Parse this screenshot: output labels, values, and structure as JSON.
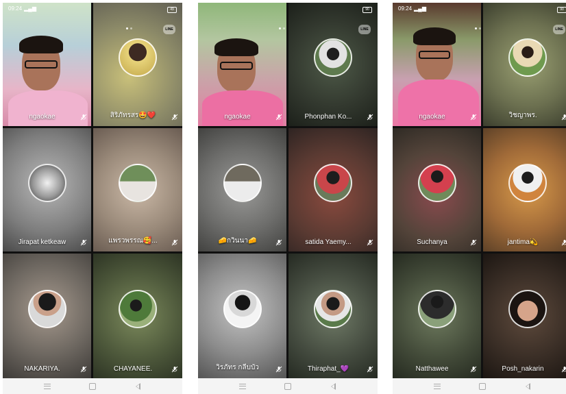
{
  "colors": {
    "navbar": "#f4f4f4",
    "name_text": "#ffffff"
  },
  "phones": [
    {
      "status": {
        "time": "09:24",
        "signal": "signal-icon",
        "battery": "battery-icon"
      },
      "battery_label": "49",
      "tiles": [
        {
          "name": "ngaokae",
          "mic": "mic-muted-icon",
          "self": true
        },
        {
          "name": "สิริภัทรสร🤩❤️",
          "mic": "mic-muted-icon"
        },
        {
          "name": "Jirapat ketkeaw",
          "mic": "mic-muted-icon"
        },
        {
          "name": "แพรวพรรณ🥰...",
          "mic": "mic-muted-icon"
        },
        {
          "name": "NAKARIYA.",
          "mic": "mic-muted-icon"
        },
        {
          "name": "CHAYANEE.",
          "mic": "mic-muted-icon"
        }
      ]
    },
    {
      "status": {
        "time": "",
        "battery": "battery-icon"
      },
      "battery_label": "90",
      "tiles": [
        {
          "name": "ngaokae",
          "mic": "mic-muted-icon",
          "self": true
        },
        {
          "name": "Phonphan Ko...",
          "mic": "mic-muted-icon"
        },
        {
          "name": "🧀กวินนา🧀",
          "mic": "mic-muted-icon"
        },
        {
          "name": "satida Yaemy...",
          "mic": "mic-muted-icon"
        },
        {
          "name": "วิรภัทร กลีบบัว",
          "mic": "mic-muted-icon"
        },
        {
          "name": "Thiraphat_💜",
          "mic": "mic-muted-icon"
        }
      ]
    },
    {
      "status": {
        "time": "09:24",
        "signal": "signal-icon",
        "battery": "battery-icon"
      },
      "battery_label": "90",
      "tiles": [
        {
          "name": "ngaokae",
          "mic": "mic-muted-icon",
          "self": true
        },
        {
          "name": "วิชญาพร.",
          "mic": "mic-muted-icon"
        },
        {
          "name": "Suchanya",
          "mic": "mic-muted-icon"
        },
        {
          "name": "jantima💫",
          "mic": "mic-muted-icon"
        },
        {
          "name": "Natthawee",
          "mic": "mic-muted-icon"
        },
        {
          "name": "Posh_nakarin",
          "mic": "mic-muted-icon"
        }
      ]
    }
  ],
  "app_logo": "LINE",
  "navbar": {
    "menu": "menu-icon",
    "home": "home-icon",
    "back": "back-icon"
  }
}
